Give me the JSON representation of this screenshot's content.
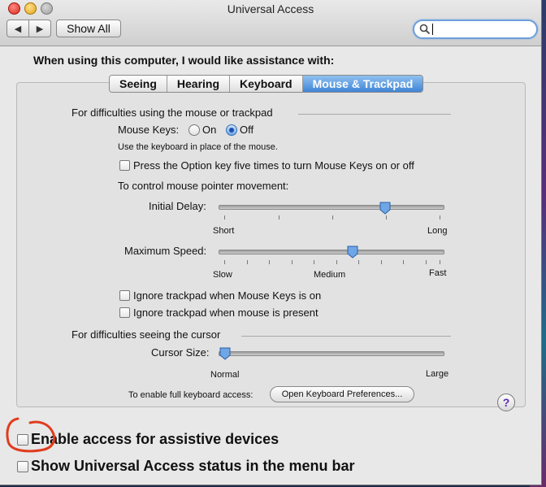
{
  "window": {
    "title": "Universal Access",
    "show_all_label": "Show All"
  },
  "toolbar": {
    "back_icon": "back-arrow-icon",
    "forward_icon": "forward-arrow-icon",
    "search_value": ""
  },
  "main": {
    "heading": "When using this computer, I would like assistance with:",
    "tabs": [
      {
        "label": "Seeing",
        "active": false
      },
      {
        "label": "Hearing",
        "active": false
      },
      {
        "label": "Keyboard",
        "active": false
      },
      {
        "label": "Mouse & Trackpad",
        "active": true
      }
    ],
    "mouse_section": {
      "title": "For difficulties using the mouse or trackpad",
      "mouse_keys_label": "Mouse Keys:",
      "on_label": "On",
      "off_label": "Off",
      "selected": "Off",
      "hint": "Use the keyboard in place of the mouse.",
      "option_key_checkbox": "Press the Option key five times to turn Mouse Keys on or off",
      "control_label": "To control mouse pointer movement:",
      "initial_delay": {
        "label": "Initial Delay:",
        "min_label": "Short",
        "max_label": "Long",
        "value_fraction": 0.74
      },
      "max_speed": {
        "label": "Maximum Speed:",
        "min_label": "Slow",
        "mid_label": "Medium",
        "max_label": "Fast",
        "value_fraction": 0.59
      },
      "ignore_when_mousekeys": "Ignore trackpad when Mouse Keys is on",
      "ignore_when_mouse": "Ignore trackpad when mouse is present"
    },
    "cursor_section": {
      "title": "For difficulties seeing the cursor",
      "cursor_size": {
        "label": "Cursor Size:",
        "min_label": "Normal",
        "max_label": "Large",
        "value_fraction": 0.0
      },
      "keyboard_access_text": "To enable full keyboard access:",
      "open_keyboard_prefs_button": "Open Keyboard Preferences..."
    },
    "help_label": "?"
  },
  "bottom": {
    "enable_assistive": "Enable access for assistive devices",
    "show_status_menu": "Show Universal Access status in the menu bar"
  },
  "colors": {
    "active_tab": "#3f84d6",
    "annotation": "#e03c1e",
    "focus_ring": "#6f9fd9"
  }
}
